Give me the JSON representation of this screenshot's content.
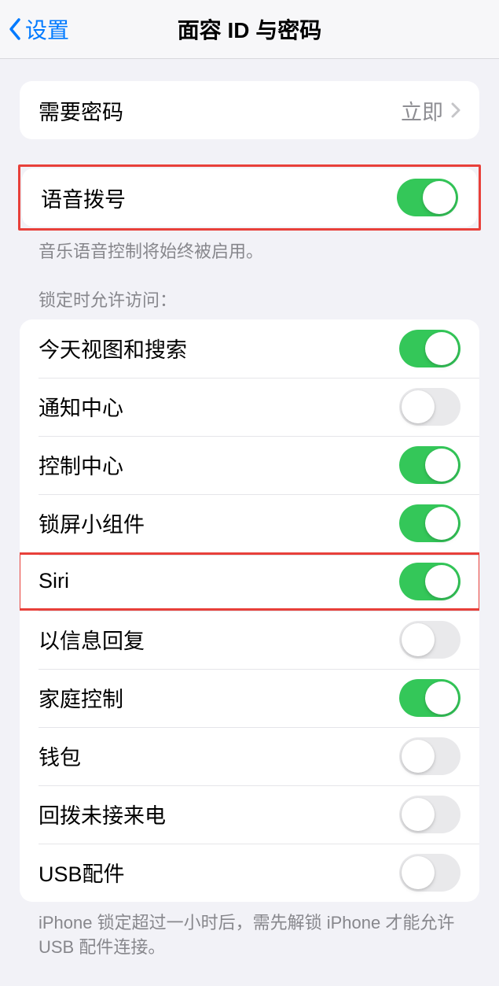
{
  "nav": {
    "back_label": "设置",
    "title": "面容 ID 与密码"
  },
  "passcode_group": {
    "require_passcode_label": "需要密码",
    "require_passcode_value": "立即"
  },
  "voice_dial": {
    "label": "语音拨号",
    "enabled": true,
    "footer": "音乐语音控制将始终被启用。"
  },
  "lock_access": {
    "header": "锁定时允许访问：",
    "items": [
      {
        "label": "今天视图和搜索",
        "enabled": true
      },
      {
        "label": "通知中心",
        "enabled": false
      },
      {
        "label": "控制中心",
        "enabled": true
      },
      {
        "label": "锁屏小组件",
        "enabled": true
      },
      {
        "label": "Siri",
        "enabled": true
      },
      {
        "label": "以信息回复",
        "enabled": false
      },
      {
        "label": "家庭控制",
        "enabled": true
      },
      {
        "label": "钱包",
        "enabled": false
      },
      {
        "label": "回拨未接来电",
        "enabled": false
      },
      {
        "label": "USB配件",
        "enabled": false
      }
    ],
    "footer": "iPhone 锁定超过一小时后，需先解锁 iPhone 才能允许 USB 配件连接。"
  }
}
